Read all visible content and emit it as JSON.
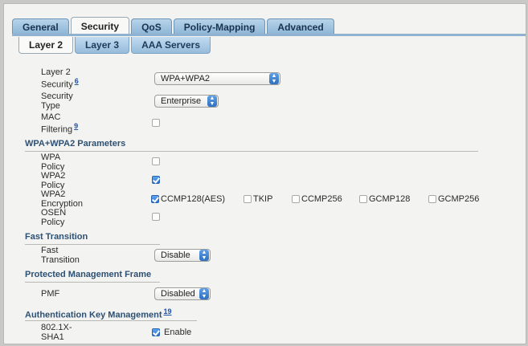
{
  "tabs": [
    "General",
    "Security",
    "QoS",
    "Policy-Mapping",
    "Advanced"
  ],
  "subtabs": [
    "Layer 2",
    "Layer 3",
    "AAA Servers"
  ],
  "layer2": {
    "security_label": "Layer 2 Security",
    "security_sup": "6",
    "security_value": "WPA+WPA2",
    "type_label": "Security Type",
    "type_value": "Enterprise",
    "mac_label": "MAC Filtering",
    "mac_sup": "9",
    "mac_checked": false
  },
  "wpa_section": {
    "title": "WPA+WPA2 Parameters",
    "wpa_policy_label": "WPA Policy",
    "wpa_policy_checked": false,
    "wpa2_policy_label": "WPA2 Policy",
    "wpa2_policy_checked": true,
    "wpa2_encryption_label": "WPA2 Encryption",
    "encryption": [
      {
        "label": "CCMP128(AES)",
        "checked": true
      },
      {
        "label": "TKIP",
        "checked": false
      },
      {
        "label": "CCMP256",
        "checked": false
      },
      {
        "label": "GCMP128",
        "checked": false
      },
      {
        "label": "GCMP256",
        "checked": false
      }
    ],
    "osen_label": "OSEN Policy",
    "osen_checked": false
  },
  "fast_transition": {
    "title": "Fast Transition",
    "label": "Fast Transition",
    "value": "Disable"
  },
  "pmf_section": {
    "title": "Protected Management Frame",
    "label": "PMF",
    "value": "Disabled"
  },
  "akm": {
    "title": "Authentication Key Management",
    "title_sup": "19",
    "label": "802.1X-SHA1",
    "checked": true,
    "enable_label": "Enable"
  }
}
